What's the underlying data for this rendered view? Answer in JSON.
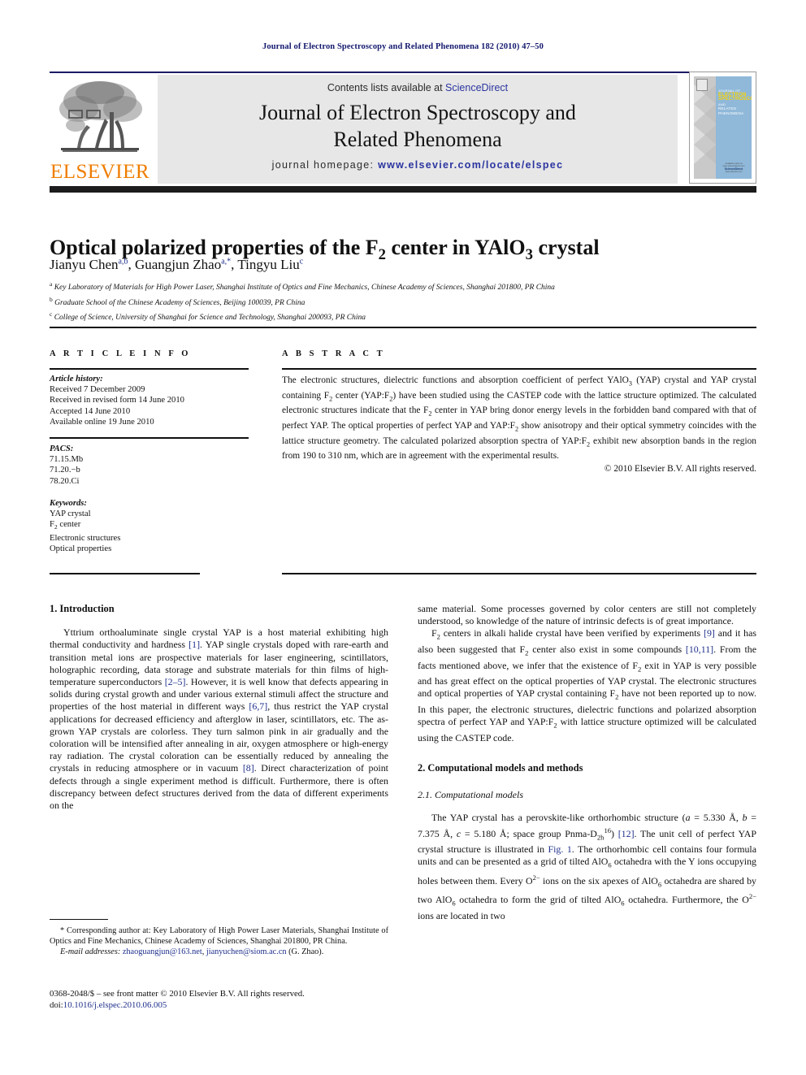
{
  "running_head": "Journal of Electron Spectroscopy and Related Phenomena 182 (2010) 47–50",
  "masthead": {
    "contents_prefix": "Contents lists available at ",
    "contents_link": "ScienceDirect",
    "journal_title_line1": "Journal of Electron Spectroscopy and",
    "journal_title_line2": "Related Phenomena",
    "homepage_prefix": "journal homepage:",
    "homepage_url": "www.elsevier.com/locate/elspec",
    "publisher": "ELSEVIER",
    "cover": {
      "line1": "JOURNAL OF",
      "line2": "ELECTRON",
      "line3": "SPECTROSCOPY",
      "line4": "AND",
      "line5": "RELATED PHENOMENA",
      "foot1": "Available online at www.sciencedirect.com",
      "foot2": "ScienceDirect",
      "foot3": "www.elsevier.com"
    }
  },
  "article": {
    "title_part1": "Optical polarized properties of the F",
    "title_sub": "2",
    "title_part2": " center in YAlO",
    "title_sub2": "3",
    "title_part3": " crystal",
    "authors": [
      {
        "name": "Jianyu Chen",
        "marks": "a,b"
      },
      {
        "name": "Guangjun Zhao",
        "marks": "a,*"
      },
      {
        "name": "Tingyu Liu",
        "marks": "c"
      }
    ],
    "affiliations": [
      {
        "mark": "a",
        "text": "Key Laboratory of Materials for High Power Laser, Shanghai Institute of Optics and Fine Mechanics, Chinese Academy of Sciences, Shanghai 201800, PR China"
      },
      {
        "mark": "b",
        "text": "Graduate School of the Chinese Academy of Sciences, Beijing 100039, PR China"
      },
      {
        "mark": "c",
        "text": "College of Science, University of Shanghai for Science and Technology, Shanghai 200093, PR China"
      }
    ]
  },
  "article_info": {
    "heading": "A R T I C L E    I N F O",
    "history_label": "Article history:",
    "history": [
      "Received 7 December 2009",
      "Received in revised form 14 June 2010",
      "Accepted 14 June 2010",
      "Available online 19 June 2010"
    ],
    "pacs_label": "PACS:",
    "pacs": [
      "71.15.Mb",
      "71.20.−b",
      "78.20.Ci"
    ],
    "keywords_label": "Keywords:",
    "keywords": [
      "YAP crystal",
      "F2 center",
      "Electronic structures",
      "Optical properties"
    ]
  },
  "abstract": {
    "heading": "A B S T R A C T",
    "text": "The electronic structures, dielectric functions and absorption coefficient of perfect YAlO3 (YAP) crystal and YAP crystal containing F2 center (YAP:F2) have been studied using the CASTEP code with the lattice structure optimized. The calculated electronic structures indicate that the F2 center in YAP bring donor energy levels in the forbidden band compared with that of perfect YAP. The optical properties of perfect YAP and YAP:F2 show anisotropy and their optical symmetry coincides with the lattice structure geometry. The calculated polarized absorption spectra of YAP:F2 exhibit new absorption bands in the region from 190 to 310 nm, which are in agreement with the experimental results.",
    "copyright": "© 2010 Elsevier B.V. All rights reserved."
  },
  "body": {
    "section1_heading": "1.  Introduction",
    "section1_p1": "Yttrium orthoaluminate single crystal YAP is a host material exhibiting high thermal conductivity and hardness [1]. YAP single crystals doped with rare-earth and transition metal ions are prospective materials for laser engineering, scintillators, holographic recording, data storage and substrate materials for thin films of high-temperature superconductors [2–5]. However, it is well know that defects appearing in solids during crystal growth and under various external stimuli affect the structure and properties of the host material in different ways [6,7], thus restrict the YAP crystal applications for decreased efficiency and afterglow in laser, scintillators, etc. The as-grown YAP crystals are colorless. They turn salmon pink in air gradually and the coloration will be intensified after annealing in air, oxygen atmosphere or high-energy ray radiation. The crystal coloration can be essentially reduced by annealing the crystals in reducing atmosphere or in vacuum [8]. Direct characterization of point defects through a single experiment method is difficult. Furthermore, there is often discrepancy between defect structures derived from the data of different experiments on the same material. Some processes governed by color centers are still not completely understood, so knowledge of the nature of intrinsic defects is of great importance.",
    "section1_p2": "F2 centers in alkali halide crystal have been verified by experiments [9] and it has also been suggested that F2 center also exist in some compounds [10,11]. From the facts mentioned above, we infer that the existence of F2 exit in YAP is very possible and has great effect on the optical properties of YAP crystal. The electronic structures and optical properties of YAP crystal containing F2 have not been reported up to now. In this paper, the electronic structures, dielectric functions and polarized absorption spectra of perfect YAP and YAP:F2 with lattice structure optimized will be calculated using the CASTEP code.",
    "section2_heading": "2.  Computational models and methods",
    "section21_heading": "2.1.  Computational models",
    "section21_p1": "The YAP crystal has a perovskite-like orthorhombic structure (a = 5.330 Å, b = 7.375 Å, c = 5.180 Å; space group Pnma-D2h16) [12]. The unit cell of perfect YAP crystal structure is illustrated in Fig. 1. The orthorhombic cell contains four formula units and can be presented as a grid of tilted AlO6 octahedra with the Y ions occupying holes between them. Every O2− ions on the six apexes of AlO6 octahedra are shared by two AlO6 octahedra to form the grid of tilted AlO6 octahedra. Furthermore, the O2− ions are located in two"
  },
  "footnotes": {
    "corresponding": "* Corresponding author at: Key Laboratory of High Power Laser Materials, Shanghai Institute of Optics and Fine Mechanics, Chinese Academy of Sciences, Shanghai 201800, PR China.",
    "email_label": "E-mail addresses:",
    "email1": "zhaoguangjun@163.net",
    "email2": "jianyuchen@siom.ac.cn",
    "email_attrib": "(G. Zhao).",
    "imprint": "0368-2048/$ – see front matter © 2010 Elsevier B.V. All rights reserved.",
    "doi_label": "doi:",
    "doi_value": "10.1016/j.elspec.2010.06.005"
  },
  "colors": {
    "link": "#1e2f8c",
    "running_head": "#14196e",
    "elsevier_orange": "#ef7d00",
    "banner_grey": "#e7e7e7",
    "bar_dark": "#1c1c1c",
    "cover_blue": "#8fb8d9",
    "cover_yellow": "#ffd400"
  }
}
